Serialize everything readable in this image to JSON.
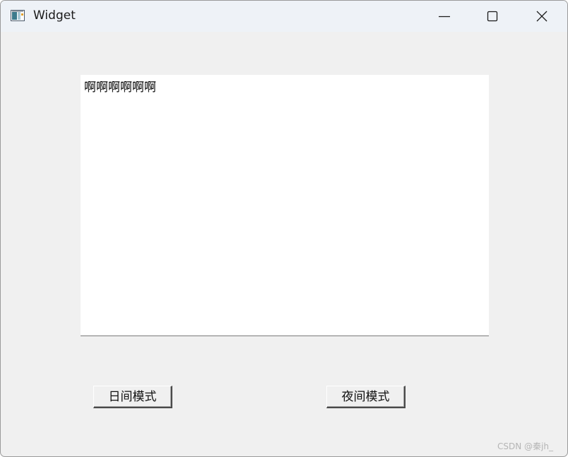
{
  "window": {
    "title": "Widget",
    "app_icon": "qt-widget-app-icon",
    "controls": {
      "minimize_icon": "minimize-icon",
      "maximize_icon": "maximize-icon",
      "close_icon": "close-icon"
    }
  },
  "editor": {
    "text": "啊啊啊啊啊啊"
  },
  "buttons": {
    "day_mode": "日间模式",
    "night_mode": "夜间模式"
  },
  "watermark": {
    "text": "CSDN @秦jh_"
  },
  "colors": {
    "window_background": "#f0f0f0",
    "titlebar_background": "#eef2f7",
    "editor_background": "#ffffff"
  }
}
